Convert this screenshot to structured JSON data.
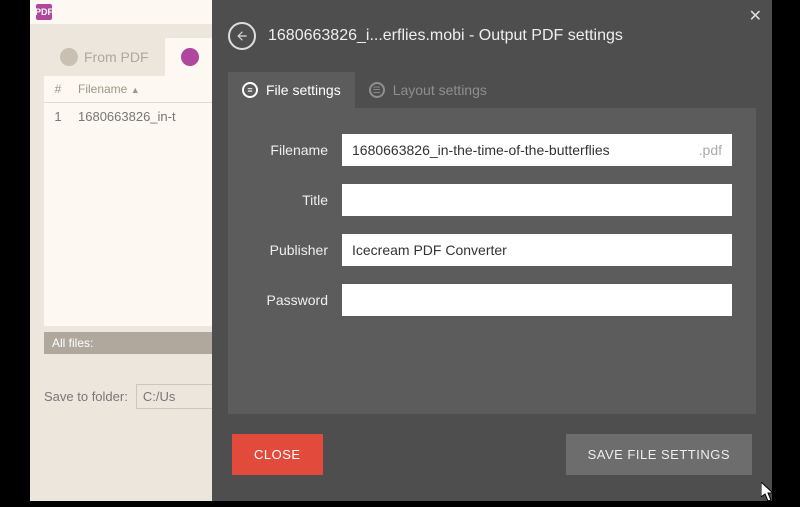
{
  "app": {
    "logo_text": "PDF",
    "tabs": {
      "from_pdf": "From PDF",
      "to_pdf": ""
    },
    "table": {
      "header_num": "#",
      "header_filename": "Filename",
      "row_num": "1",
      "row_filename": "1680663826_in-t"
    },
    "allfiles_label": "All files:",
    "save_label": "Save to folder:",
    "save_value": "C:/Us"
  },
  "modal": {
    "title": "1680663826_i...erflies.mobi - Output PDF settings",
    "tabs": {
      "file": "File settings",
      "layout": "Layout settings"
    },
    "form": {
      "filename_label": "Filename",
      "filename_value": "1680663826_in-the-time-of-the-butterflies",
      "filename_ext": ".pdf",
      "title_label": "Title",
      "title_value": "",
      "publisher_label": "Publisher",
      "publisher_value": "Icecream PDF Converter",
      "password_label": "Password",
      "password_value": ""
    },
    "buttons": {
      "close": "CLOSE",
      "save": "SAVE FILE SETTINGS"
    }
  }
}
